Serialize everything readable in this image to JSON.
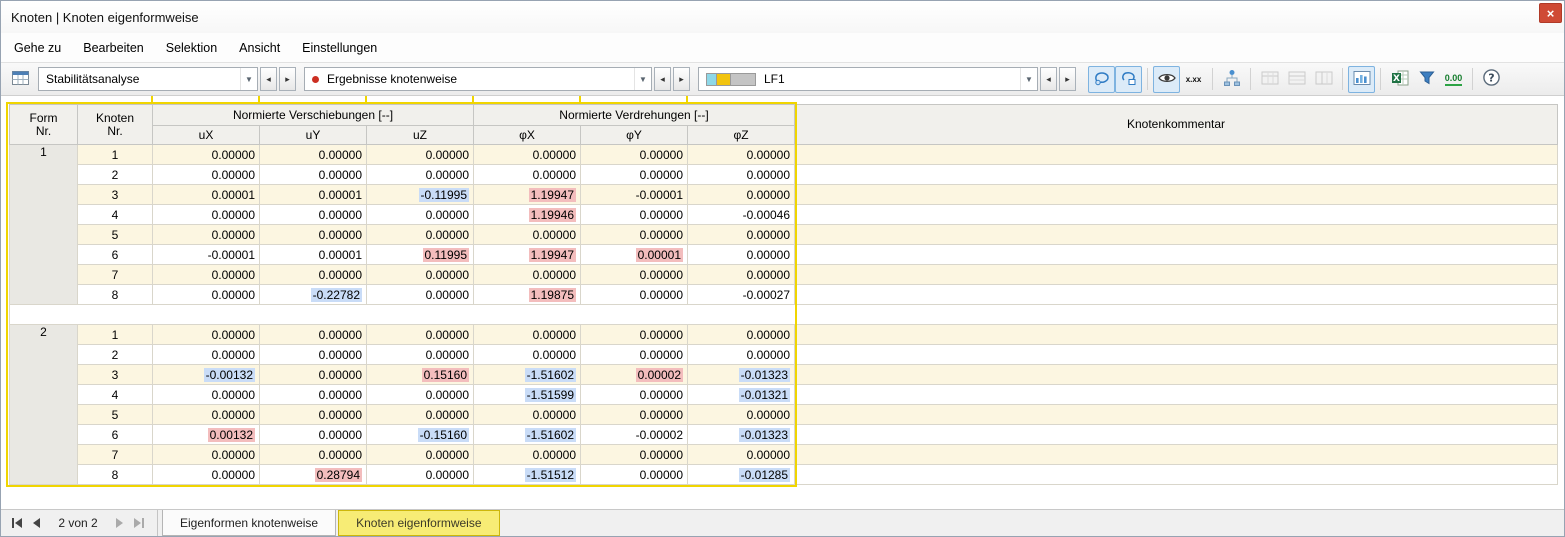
{
  "colors": {
    "selection_yellow": "#f0d500",
    "highlight_max": "#f3bdbd",
    "highlight_min": "#c9dcf7",
    "row_stripe": "#fcf6e1",
    "close_red": "#cf4a35",
    "tab_active_bg": "#f7ec75",
    "swatch_cyan": "#8ed8e8",
    "swatch_yellow": "#f2c40f",
    "swatch_gray": "#c4c4c4"
  },
  "window": {
    "title": "Knoten | Knoten eigenformweise",
    "close_label": "×"
  },
  "menu": {
    "items": [
      "Gehe zu",
      "Bearbeiten",
      "Selektion",
      "Ansicht",
      "Einstellungen"
    ]
  },
  "toolbar": {
    "analysis_value": "Stabilitätsanalyse",
    "results_value": "Ergebnisse knotenweise",
    "loadcase_value": "LF1",
    "decimal_icon_label": "x.xx",
    "zeros_icon_label": "0.00",
    "help_icon_label": "?"
  },
  "table": {
    "headers": {
      "form_line1": "Form",
      "form_line2": "Nr.",
      "node_line1": "Knoten",
      "node_line2": "Nr.",
      "displacements_group": "Normierte Verschiebungen [--]",
      "rotations_group": "Normierte Verdrehungen [--]",
      "columns": [
        "uX",
        "uY",
        "uZ",
        "φX",
        "φY",
        "φZ"
      ],
      "comment": "Knotenkommentar"
    },
    "groups": [
      {
        "form": "1",
        "rows": [
          {
            "node": "1",
            "values": [
              "0.00000",
              "0.00000",
              "0.00000",
              "0.00000",
              "0.00000",
              "0.00000"
            ],
            "hl": [
              "",
              "",
              "",
              "",
              "",
              ""
            ]
          },
          {
            "node": "2",
            "values": [
              "0.00000",
              "0.00000",
              "0.00000",
              "0.00000",
              "0.00000",
              "0.00000"
            ],
            "hl": [
              "",
              "",
              "",
              "",
              "",
              ""
            ]
          },
          {
            "node": "3",
            "values": [
              "0.00001",
              "0.00001",
              "-0.11995",
              "1.19947",
              "-0.00001",
              "0.00000"
            ],
            "hl": [
              "",
              "",
              "min",
              "max",
              "",
              ""
            ]
          },
          {
            "node": "4",
            "values": [
              "0.00000",
              "0.00000",
              "0.00000",
              "1.19946",
              "0.00000",
              "-0.00046"
            ],
            "hl": [
              "",
              "",
              "",
              "max",
              "",
              ""
            ]
          },
          {
            "node": "5",
            "values": [
              "0.00000",
              "0.00000",
              "0.00000",
              "0.00000",
              "0.00000",
              "0.00000"
            ],
            "hl": [
              "",
              "",
              "",
              "",
              "",
              ""
            ]
          },
          {
            "node": "6",
            "values": [
              "-0.00001",
              "0.00001",
              "0.11995",
              "1.19947",
              "0.00001",
              "0.00000"
            ],
            "hl": [
              "",
              "",
              "max",
              "max",
              "max",
              ""
            ]
          },
          {
            "node": "7",
            "values": [
              "0.00000",
              "0.00000",
              "0.00000",
              "0.00000",
              "0.00000",
              "0.00000"
            ],
            "hl": [
              "",
              "",
              "",
              "",
              "",
              ""
            ]
          },
          {
            "node": "8",
            "values": [
              "0.00000",
              "-0.22782",
              "0.00000",
              "1.19875",
              "0.00000",
              "-0.00027"
            ],
            "hl": [
              "",
              "min",
              "",
              "max",
              "",
              ""
            ]
          }
        ]
      },
      {
        "form": "2",
        "rows": [
          {
            "node": "1",
            "values": [
              "0.00000",
              "0.00000",
              "0.00000",
              "0.00000",
              "0.00000",
              "0.00000"
            ],
            "hl": [
              "",
              "",
              "",
              "",
              "",
              ""
            ]
          },
          {
            "node": "2",
            "values": [
              "0.00000",
              "0.00000",
              "0.00000",
              "0.00000",
              "0.00000",
              "0.00000"
            ],
            "hl": [
              "",
              "",
              "",
              "",
              "",
              ""
            ]
          },
          {
            "node": "3",
            "values": [
              "-0.00132",
              "0.00000",
              "0.15160",
              "-1.51602",
              "0.00002",
              "-0.01323"
            ],
            "hl": [
              "min",
              "",
              "max",
              "min",
              "max",
              "min"
            ]
          },
          {
            "node": "4",
            "values": [
              "0.00000",
              "0.00000",
              "0.00000",
              "-1.51599",
              "0.00000",
              "-0.01321"
            ],
            "hl": [
              "",
              "",
              "",
              "min",
              "",
              "min"
            ]
          },
          {
            "node": "5",
            "values": [
              "0.00000",
              "0.00000",
              "0.00000",
              "0.00000",
              "0.00000",
              "0.00000"
            ],
            "hl": [
              "",
              "",
              "",
              "",
              "",
              ""
            ]
          },
          {
            "node": "6",
            "values": [
              "0.00132",
              "0.00000",
              "-0.15160",
              "-1.51602",
              "-0.00002",
              "-0.01323"
            ],
            "hl": [
              "max",
              "",
              "min",
              "min",
              "",
              "min"
            ]
          },
          {
            "node": "7",
            "values": [
              "0.00000",
              "0.00000",
              "0.00000",
              "0.00000",
              "0.00000",
              "0.00000"
            ],
            "hl": [
              "",
              "",
              "",
              "",
              "",
              ""
            ]
          },
          {
            "node": "8",
            "values": [
              "0.00000",
              "0.28794",
              "0.00000",
              "-1.51512",
              "0.00000",
              "-0.01285"
            ],
            "hl": [
              "",
              "max",
              "",
              "min",
              "",
              "min"
            ]
          }
        ]
      }
    ]
  },
  "footer": {
    "pager_text": "2 von 2",
    "tabs": [
      {
        "label": "Eigenformen knotenweise",
        "active": false
      },
      {
        "label": "Knoten eigenformweise",
        "active": true
      }
    ]
  }
}
